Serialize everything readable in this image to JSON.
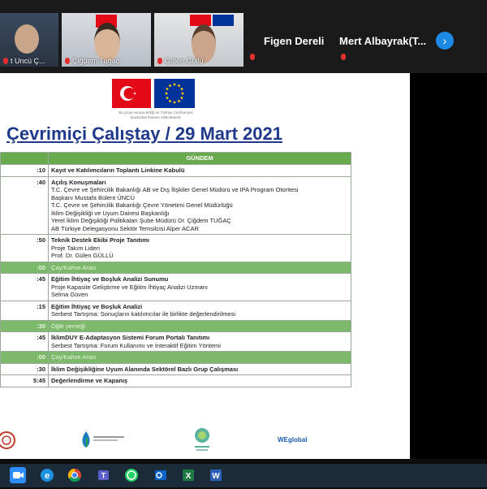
{
  "participants": [
    {
      "name": "t Uncü Ç..."
    },
    {
      "name": "Çiğdem Tuğaç"
    },
    {
      "name": "Gülen Güllü"
    },
    {
      "name": "Figen Dereli"
    },
    {
      "name": "Mert Albayrak(T..."
    }
  ],
  "next_button": "›",
  "document": {
    "flag_caption": "Bu proje Avrupa Birliği ve Türkiye Cumhuriyeti tarafından finanse edilmektedir.",
    "title": "Çevrimiçi Çalıştay / 29 Mart 2021",
    "agenda_header": "GÜNDEM",
    "rows": [
      {
        "time": ":10",
        "lines": [
          "Kayıt ve Katılımcıların Toplantı Linkine Kabulü"
        ],
        "bold_first": true,
        "break": false
      },
      {
        "time": ":40",
        "lines": [
          "Açılış Konuşmaları",
          "T.C. Çevre ve Şehircilik Bakanlığı AB ve Dış İlişkiler Genel Müdürü ve IPA Program Otoritesi",
          "Başkanı Mustafa Bülent ÜNCÜ",
          "T.C. Çevre ve Şehircilik Bakanlığı Çevre Yönetimi Genel Müdürlüğü",
          "İklim Değişikliği ve Uyum Dairesi Başkanlığı",
          "Yerel İklim Değişikliği Politikaları Şube Müdürü Dr. Çiğdem TUĞAÇ",
          "AB Türkiye Delegasyonu Sektör Temsilcisi Alper ACAR"
        ],
        "bold_first": true,
        "break": false
      },
      {
        "time": ":50",
        "lines": [
          "Teknik Destek Ekibi Proje Tanıtımı",
          "Proje Takım Lideri",
          "Prof. Dr. Gülen GÜLLÜ"
        ],
        "bold_first": true,
        "break": false
      },
      {
        "time": ":00",
        "lines": [
          "Çay/Kahve Arası"
        ],
        "bold_first": false,
        "break": true
      },
      {
        "time": ":45",
        "lines": [
          "Eğitim İhtiyaç ve Boşluk Analizi Sunumu",
          "Proje Kapasite Geliştirme ve Eğitim İhtiyaç Analizi Uzmanı",
          "Selma Güven"
        ],
        "bold_first": true,
        "break": false
      },
      {
        "time": ":15",
        "lines": [
          "Eğitim İhtiyaç ve Boşluk Analizi",
          "Serbest Tartışma: Sonuçların katılımcılar ile birlikte değerlendirilmesi"
        ],
        "bold_first": true,
        "break": false
      },
      {
        "time": ":30",
        "lines": [
          "Öğle yemeği"
        ],
        "bold_first": false,
        "break": true
      },
      {
        "time": ":45",
        "lines": [
          "İklimDUY E-Adaptasyon Sistemi Forum Portalı Tanıtımı",
          "Serbest Tartışma: Forum Kullanımı ve İnteraktif Eğitim Yöntemi"
        ],
        "bold_first": true,
        "break": false
      },
      {
        "time": ":00",
        "lines": [
          "Çay/Kahve Arası"
        ],
        "bold_first": false,
        "break": true
      },
      {
        "time": ":30",
        "lines": [
          "İklim Değişikliğine Uyum Alanında Sektörel Bazlı Grup Çalışması"
        ],
        "bold_first": true,
        "break": false
      },
      {
        "time": "5:45",
        "lines": [
          "Değerlendirme ve Kapanış"
        ],
        "bold_first": true,
        "break": false
      }
    ],
    "footer_logo_text": "WEglobal"
  },
  "colors": {
    "agenda_green": "#6aaa4e",
    "title_blue": "#1f3a8a",
    "turkey_red": "#e30a17",
    "eu_blue": "#003399"
  },
  "taskbar_icons": [
    "zoom-icon",
    "edge-icon",
    "chrome-icon",
    "teams-icon",
    "whatsapp-icon",
    "outlook-icon",
    "excel-icon",
    "word-icon"
  ]
}
